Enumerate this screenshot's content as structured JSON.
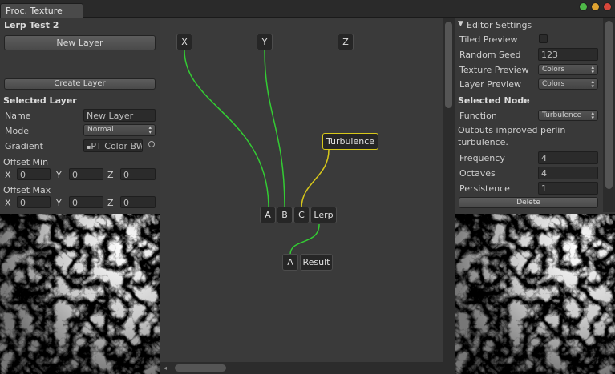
{
  "window": {
    "tab_title": "Proc. Texture"
  },
  "left_panel": {
    "texture_name": "Lerp Test 2",
    "new_layer_button": "New Layer",
    "create_layer_button": "Create Layer",
    "section_title": "Selected Layer",
    "name_label": "Name",
    "name_value": "New Layer",
    "mode_label": "Mode",
    "mode_value": "Normal",
    "gradient_label": "Gradient",
    "gradient_value": "PT Color BW",
    "offset_min_label": "Offset Min",
    "offset_max_label": "Offset Max",
    "axis_x": "X",
    "axis_y": "Y",
    "axis_z": "Z",
    "offset_min": {
      "x": "0",
      "y": "0",
      "z": "0"
    },
    "offset_max": {
      "x": "0",
      "y": "0",
      "z": "0"
    }
  },
  "graph": {
    "nodes": {
      "x": "X",
      "y": "Y",
      "z": "Z",
      "turbulence": "Turbulence",
      "lerp_a": "A",
      "lerp_b": "B",
      "lerp_c": "C",
      "lerp": "Lerp",
      "result_a": "A",
      "result": "Result"
    },
    "colors": {
      "wire_green": "#33cc33",
      "wire_yellow": "#d8c81a",
      "turbulence_border": "#d8c81a"
    }
  },
  "right_panel": {
    "editor_settings_title": "Editor Settings",
    "tiled_preview_label": "Tiled Preview",
    "tiled_preview_checked": false,
    "random_seed_label": "Random Seed",
    "random_seed_value": "123",
    "texture_preview_label": "Texture Preview",
    "texture_preview_value": "Colors",
    "layer_preview_label": "Layer Preview",
    "layer_preview_value": "Colors",
    "selected_node_title": "Selected Node",
    "function_label": "Function",
    "function_value": "Turbulence",
    "description": "Outputs improved perlin turbulence.",
    "frequency_label": "Frequency",
    "frequency_value": "4",
    "octaves_label": "Octaves",
    "octaves_value": "4",
    "persistence_label": "Persistence",
    "persistence_value": "1",
    "delete_button": "Delete"
  }
}
